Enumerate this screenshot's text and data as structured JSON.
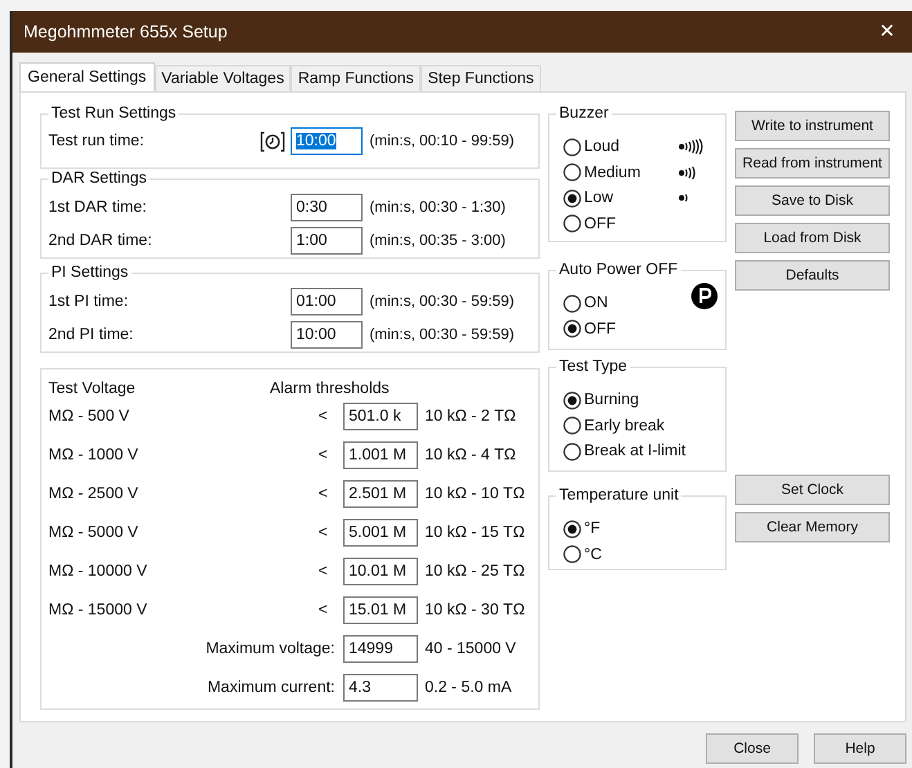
{
  "window": {
    "title": "Megohmmeter 655x Setup",
    "close": "✕"
  },
  "tabs": [
    {
      "label": "General Settings",
      "selected": true
    },
    {
      "label": "Variable Voltages",
      "selected": false
    },
    {
      "label": "Ramp Functions",
      "selected": false
    },
    {
      "label": "Step Functions",
      "selected": false
    }
  ],
  "time_groups": [
    {
      "title": "Test Run Settings",
      "fields": [
        {
          "label": "Test run time:",
          "value": "10:00",
          "hint": "(min:s, 00:10 - 99:59)",
          "focused": true,
          "kind": "timer"
        }
      ]
    },
    {
      "title": "DAR Settings",
      "fields": [
        {
          "label": "1st DAR time:",
          "value": "0:30",
          "hint": "(min:s, 00:30 - 1:30)",
          "focused": false,
          "kind": "plain"
        },
        {
          "label": "2nd DAR time:",
          "value": "1:00",
          "hint": "(min:s, 00:35 - 3:00)",
          "focused": false,
          "kind": "plain"
        }
      ]
    },
    {
      "title": "PI Settings",
      "fields": [
        {
          "label": "1st PI time:",
          "value": "01:00",
          "hint": "(min:s, 00:30 - 59:59)",
          "focused": false,
          "kind": "plain"
        },
        {
          "label": "2nd PI time:",
          "value": "10:00",
          "hint": "(min:s, 00:30 - 59:59)",
          "focused": false,
          "kind": "plain"
        }
      ]
    }
  ],
  "alarms": {
    "voltage_heading": "Test Voltage",
    "threshold_heading": "Alarm thresholds",
    "rows": [
      {
        "label": "MΩ - 500 V",
        "sign": "<",
        "value": "501.0 k",
        "range": "10 kΩ - 2 TΩ"
      },
      {
        "label": "MΩ - 1000 V",
        "sign": "<",
        "value": "1.001 M",
        "range": "10 kΩ - 4 TΩ"
      },
      {
        "label": "MΩ - 2500 V",
        "sign": "<",
        "value": "2.501 M",
        "range": "10 kΩ - 10 TΩ"
      },
      {
        "label": "MΩ - 5000 V",
        "sign": "<",
        "value": "5.001 M",
        "range": "10 kΩ - 15 TΩ"
      },
      {
        "label": "MΩ - 10000 V",
        "sign": "<",
        "value": "10.01 M",
        "range": "10 kΩ - 25 TΩ"
      },
      {
        "label": "MΩ - 15000 V",
        "sign": "<",
        "value": "15.01 M",
        "range": "10 kΩ - 30 TΩ"
      }
    ],
    "limits": [
      {
        "label": "Maximum voltage:",
        "value": "14999",
        "range": "40 - 15000 V"
      },
      {
        "label": "Maximum current:",
        "value": "4.3",
        "range": "0.2 - 5.0 mA"
      }
    ]
  },
  "radio_groups": [
    {
      "title": "Buzzer",
      "kind": "buzzer",
      "options": [
        {
          "label": "Loud",
          "selected": false,
          "kind": "loud"
        },
        {
          "label": "Medium",
          "selected": false,
          "kind": "medium"
        },
        {
          "label": "Low",
          "selected": true,
          "kind": "low"
        },
        {
          "label": "OFF",
          "selected": false,
          "kind": "none"
        }
      ]
    },
    {
      "title": "Auto Power OFF",
      "kind": "power",
      "options": [
        {
          "label": "ON",
          "selected": false,
          "kind": "none"
        },
        {
          "label": "OFF",
          "selected": true,
          "kind": "none"
        }
      ]
    },
    {
      "title": "Test Type",
      "kind": "plain",
      "options": [
        {
          "label": "Burning",
          "selected": true,
          "kind": "none"
        },
        {
          "label": "Early break",
          "selected": false,
          "kind": "none"
        },
        {
          "label": "Break at I-limit",
          "selected": false,
          "kind": "none"
        }
      ]
    },
    {
      "title": "Temperature unit",
      "kind": "plain",
      "options": [
        {
          "label": "°F",
          "selected": true,
          "kind": "none"
        },
        {
          "label": "°C",
          "selected": false,
          "kind": "none"
        }
      ]
    }
  ],
  "side_buttons": [
    "Write to instrument",
    "Read from instrument",
    "Save to Disk",
    "Load from Disk",
    "Defaults"
  ],
  "lower_buttons": [
    "Set Clock",
    "Clear Memory"
  ],
  "footer_buttons": [
    "Close",
    "Help"
  ]
}
